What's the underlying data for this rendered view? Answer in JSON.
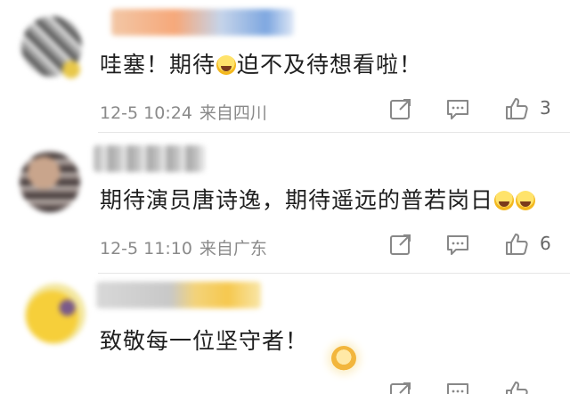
{
  "comments": [
    {
      "text_before": "哇塞！期待",
      "text_after": "迫不及待想看啦！",
      "emoji_icon": "laughing-emoji-icon",
      "time": "12-5 10:24",
      "location": "来自四川",
      "like_count": "3"
    },
    {
      "text": "期待演员唐诗逸，期待遥远的普若岗日",
      "emoji_icons": [
        "screaming-emoji-icon",
        "screaming-emoji-icon"
      ],
      "time": "12-5 11:10",
      "location": "来自广东",
      "like_count": "6"
    },
    {
      "text": "致敬每一位坚守者！",
      "badge_icon": "gold-badge-icon"
    }
  ],
  "icons": {
    "share": "share-icon",
    "comment": "comment-icon",
    "like": "thumbs-up-icon"
  },
  "colors": {
    "text": "#1f1f1f",
    "meta": "#8a8a8a",
    "divider": "#e6e6e6"
  }
}
